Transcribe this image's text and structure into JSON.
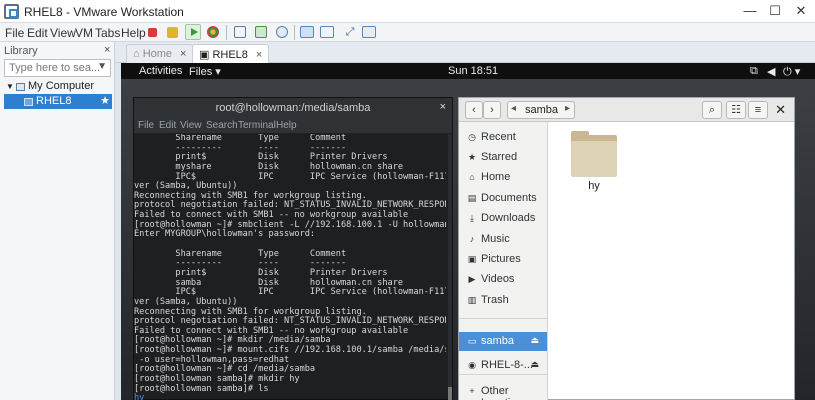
{
  "window": {
    "title": "RHEL8 - VMware Workstation",
    "controls": {
      "minimize": "—",
      "maximize": "☐",
      "close": "✕"
    }
  },
  "menu": {
    "items": [
      "File",
      "Edit",
      "View",
      "VM",
      "Tabs",
      "Help"
    ]
  },
  "library": {
    "title": "Library",
    "close": "×",
    "search_placeholder": "Type here to sea...",
    "tree": {
      "root": "My Computer",
      "vm": "RHEL8"
    }
  },
  "tabs": [
    {
      "label": "Home",
      "active": false,
      "close": "×"
    },
    {
      "label": "RHEL8",
      "active": true,
      "close": "×"
    }
  ],
  "gnome": {
    "activities": "Activities",
    "app_menu": "Files",
    "clock": "Sun 18:51"
  },
  "terminal": {
    "title": "root@hollowman:/media/samba",
    "close": "×",
    "menu": [
      "File",
      "Edit",
      "View",
      "Search",
      "Terminal",
      "Help"
    ],
    "lines": [
      "        Sharename       Type      Comment",
      "        ---------       ----      -------",
      "        print$          Disk      Printer Drivers",
      "        myshare         Disk      hollowman.cn share",
      "        IPC$            IPC       IPC Service (hollowman-F117 ser",
      "ver (Samba, Ubuntu))",
      "Reconnecting with SMB1 for workgroup listing.",
      "protocol negotiation failed: NT_STATUS_INVALID_NETWORK_RESPONSE",
      "Failed to connect with SMB1 -- no workgroup available",
      "[root@hollowman ~]# smbclient -L //192.168.100.1 -U hollowman",
      "Enter MYGROUP\\hollowman's password:",
      "",
      "        Sharename       Type      Comment",
      "        ---------       ----      -------",
      "        print$          Disk      Printer Drivers",
      "        samba           Disk      hollowman.cn share",
      "        IPC$            IPC       IPC Service (hollowman-F117 ser",
      "ver (Samba, Ubuntu))",
      "Reconnecting with SMB1 for workgroup listing.",
      "protocol negotiation failed: NT_STATUS_INVALID_NETWORK_RESPONSE",
      "Failed to connect with SMB1 -- no workgroup available",
      "[root@hollowman ~]# mkdir /media/samba",
      "[root@hollowman ~]# mount.cifs //192.168.100.1/samba /media/samba",
      " -o user=hollowman,pass=redhat",
      "[root@hollowman ~]# cd /media/samba",
      "[root@hollowman samba]# mkdir hy",
      "[root@hollowman samba]# ls",
      "hy"
    ]
  },
  "files": {
    "breadcrumb": "samba",
    "sidebar": [
      {
        "label": "Recent",
        "icon": "clock-icon",
        "glyph": "◷"
      },
      {
        "label": "Starred",
        "icon": "star-icon",
        "glyph": "★"
      },
      {
        "label": "Home",
        "icon": "home-icon",
        "glyph": "⌂"
      },
      {
        "label": "Documents",
        "icon": "document-icon",
        "glyph": "▤"
      },
      {
        "label": "Downloads",
        "icon": "download-icon",
        "glyph": "⤓"
      },
      {
        "label": "Music",
        "icon": "music-icon",
        "glyph": "♪"
      },
      {
        "label": "Pictures",
        "icon": "picture-icon",
        "glyph": "▣"
      },
      {
        "label": "Videos",
        "icon": "video-icon",
        "glyph": "▶"
      },
      {
        "label": "Trash",
        "icon": "trash-icon",
        "glyph": "▥"
      },
      {
        "label": "samba",
        "icon": "network-drive-icon",
        "glyph": "▭",
        "selected": true,
        "eject": "⏏"
      },
      {
        "label": "RHEL-8-...",
        "icon": "disc-icon",
        "glyph": "◉",
        "eject": "⏏"
      },
      {
        "label": "Other Locations",
        "icon": "plus-icon",
        "glyph": "+"
      }
    ],
    "items": [
      {
        "name": "hy",
        "type": "folder"
      }
    ]
  },
  "colors": {
    "selection": "#2f7fd1",
    "files_selection": "#4a90d9",
    "terminal_bg": "#1d2021",
    "gnome_bar": "#0f0f0f"
  }
}
